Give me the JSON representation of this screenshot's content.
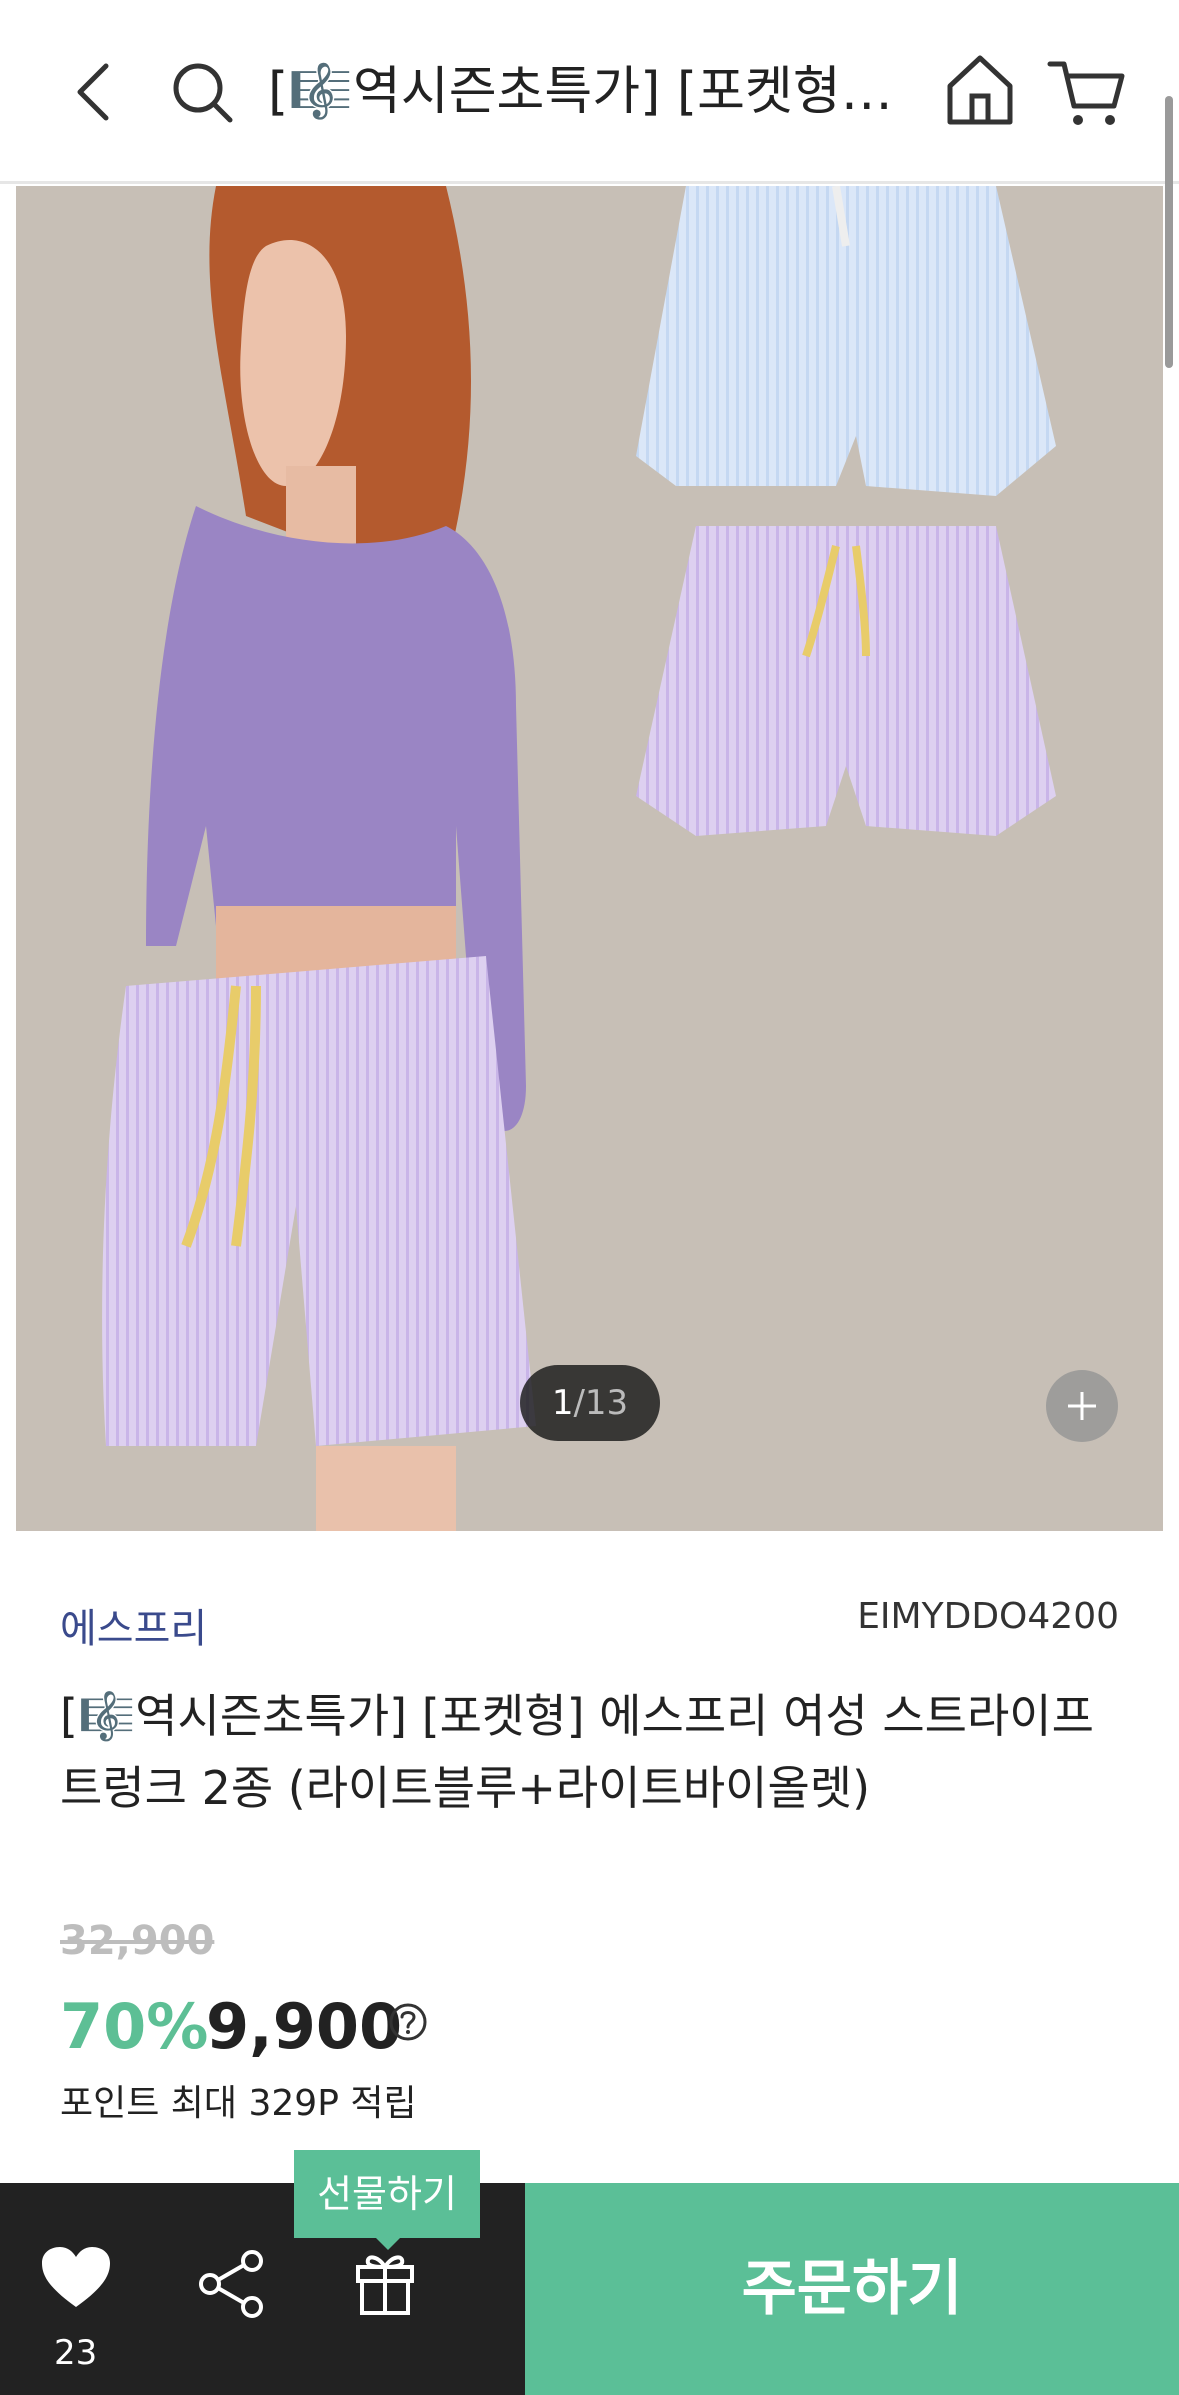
{
  "header": {
    "title": "[🎼역시즌초특가] [포켓형…",
    "back_icon": "chevron-left-icon",
    "search_icon": "search-icon",
    "home_icon": "home-icon",
    "cart_icon": "cart-icon"
  },
  "gallery": {
    "current": "1",
    "separator": "/",
    "total": "13"
  },
  "product": {
    "brand": "에스프리",
    "code": "EIMYDDO4200",
    "name": "[🎼역시즌초특가] [포켓형] 에스프리 여성 스트라이프 트렁크 2종 (라이트블루+라이트바이올렛)",
    "original_price": "32,900",
    "discount": "70%",
    "price": "9,900",
    "points": "포인트 최대 329P 적립"
  },
  "bottom": {
    "likes": "23",
    "gift_tooltip": "선물하기",
    "order_label": "주문하기"
  },
  "colors": {
    "accent": "#5bbf97",
    "discount": "#5dbf95",
    "brand": "#3a4a8c",
    "bar_dark": "#222222"
  }
}
